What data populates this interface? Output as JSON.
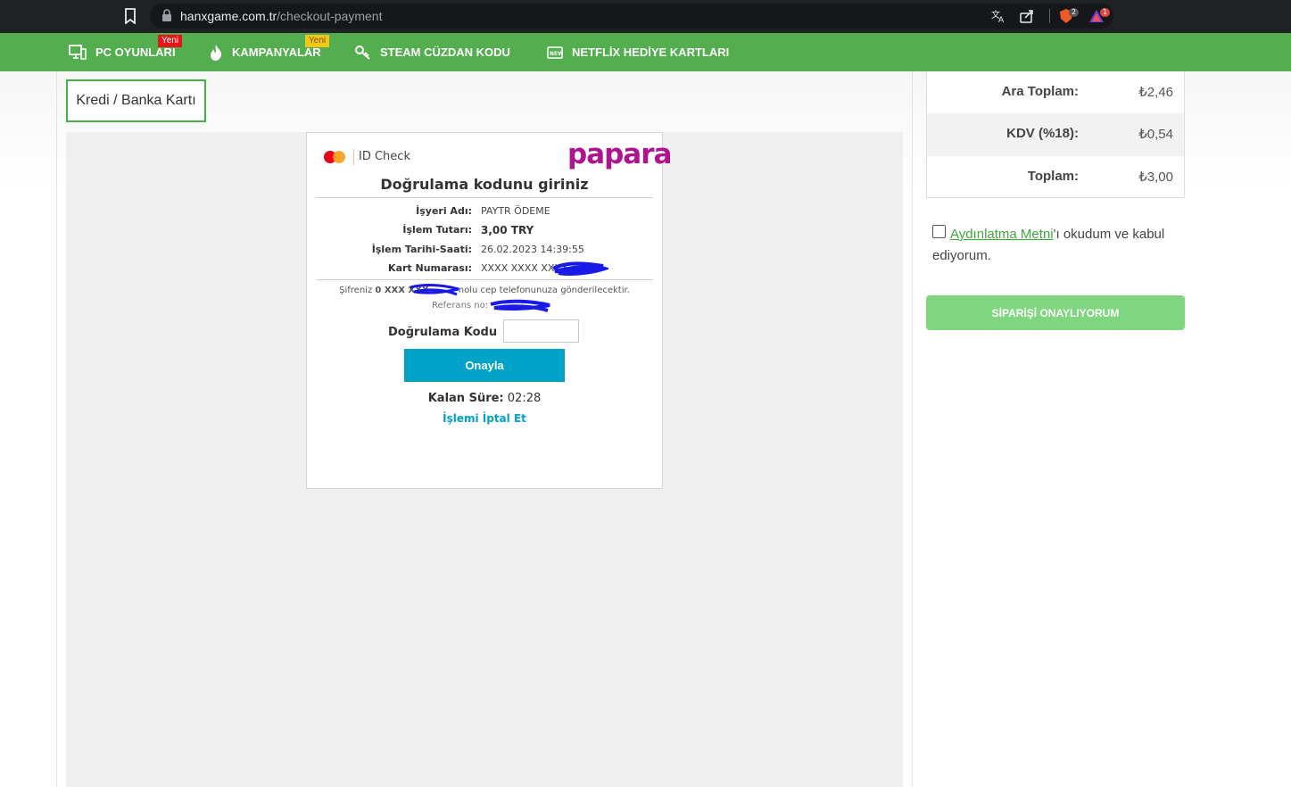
{
  "browser": {
    "url_domain": "hanxgame.com.tr",
    "url_path": "/checkout-payment",
    "brave_badge": "2",
    "rewards_badge": "1"
  },
  "nav": {
    "items": [
      {
        "label": "PC OYUNLARI",
        "tag": "Yeni"
      },
      {
        "label": "KAMPANYALAR",
        "tag": "Yeni"
      },
      {
        "label": "STEAM CÜZDAN KODU"
      },
      {
        "label": "NETFLİX HEDİYE KARTLARI"
      }
    ],
    "colors": {
      "bar": "#52ae4e",
      "tag_red": "#e8161b",
      "tag_yellow": "#f5c518"
    }
  },
  "payment": {
    "method_tab": "Kredi / Banka Kartı"
  },
  "secure": {
    "brand": "ID Check",
    "provider": "papara",
    "title": "Doğrulama kodunu giriniz",
    "rows": [
      {
        "label": "İşyeri Adı:",
        "value": "PAYTR ÖDEME"
      },
      {
        "label": "İşlem Tutarı:",
        "value": "3,00 TRY"
      },
      {
        "label": "İşlem Tarihi-Saati:",
        "value": "26.02.2023 14:39:55"
      },
      {
        "label": "Kart Numarası:",
        "value": "XXXX XXXX XXXX"
      }
    ],
    "sms_prefix": "Şifreniz ",
    "sms_phone": "0 XXX XXX",
    "sms_suffix": " nolu cep telefonunuza gönderilecektir.",
    "reference": "Referans no:",
    "code_label": "Doğrulama Kodu",
    "confirm": "Onayla",
    "timer_label": "Kalan Süre:",
    "timer_value": " 02:28",
    "cancel": "İşlemi İptal Et",
    "accent": "#00a2c7"
  },
  "summary": {
    "rows": [
      {
        "label": "Ara Toplam:",
        "value": "₺2,46"
      },
      {
        "label": "KDV (%18):",
        "value": "₺0,54"
      },
      {
        "label": "Toplam:",
        "value": "₺3,00"
      }
    ]
  },
  "consent": {
    "link": "Aydınlatma Metni",
    "text": "'ı okudum ve kabul ediyorum."
  },
  "order_button": "SİPARİŞİ ONAYLIYORUM"
}
